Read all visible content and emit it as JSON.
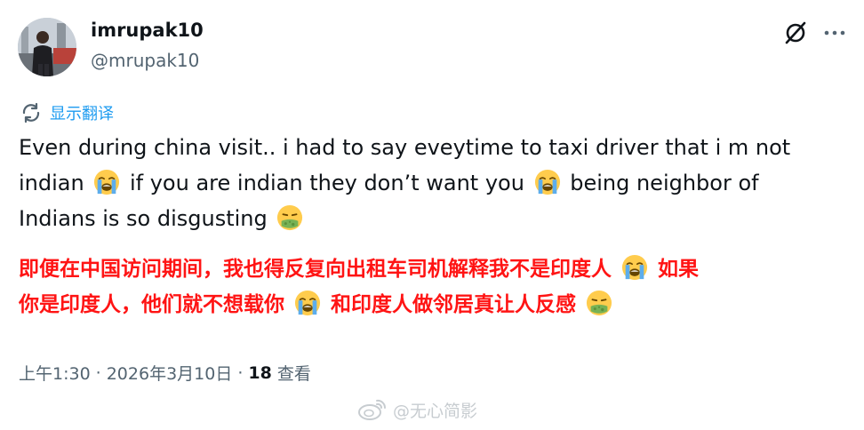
{
  "user": {
    "display_name": "imrupak10",
    "handle": "@mrupak10"
  },
  "translate": {
    "label": "显示翻译"
  },
  "tweet": {
    "en_lines": [
      "Even during china visit.. i had to say eveytime to taxi driver that i m not",
      "indian",
      "if you are indian they don’t want you",
      "being neighbor of",
      "Indians is so disgusting"
    ],
    "cn_lines": [
      "即便在中国访问期间，我也得反复向出租车司机解释我不是印度人",
      "如果",
      "你是印度人，他们就不想载你",
      "和印度人做邻居真让人反感"
    ]
  },
  "meta": {
    "time": "上午1:30",
    "separator": "·",
    "date": "2026年3月10日",
    "views_count": "18",
    "views_label": "查看"
  },
  "watermark": {
    "text": "@无心简影"
  },
  "icons": {
    "grok": "grok-icon",
    "more": "more-dots-icon",
    "translate": "translate-icon",
    "crying": "loudly-crying-face-emoji",
    "sick": "nauseated-face-emoji",
    "watermark": "weibo-logo-icon"
  },
  "colors": {
    "text": "#0f1419",
    "secondary": "#536471",
    "link": "#1d9bf0",
    "red": "#ff1414"
  }
}
